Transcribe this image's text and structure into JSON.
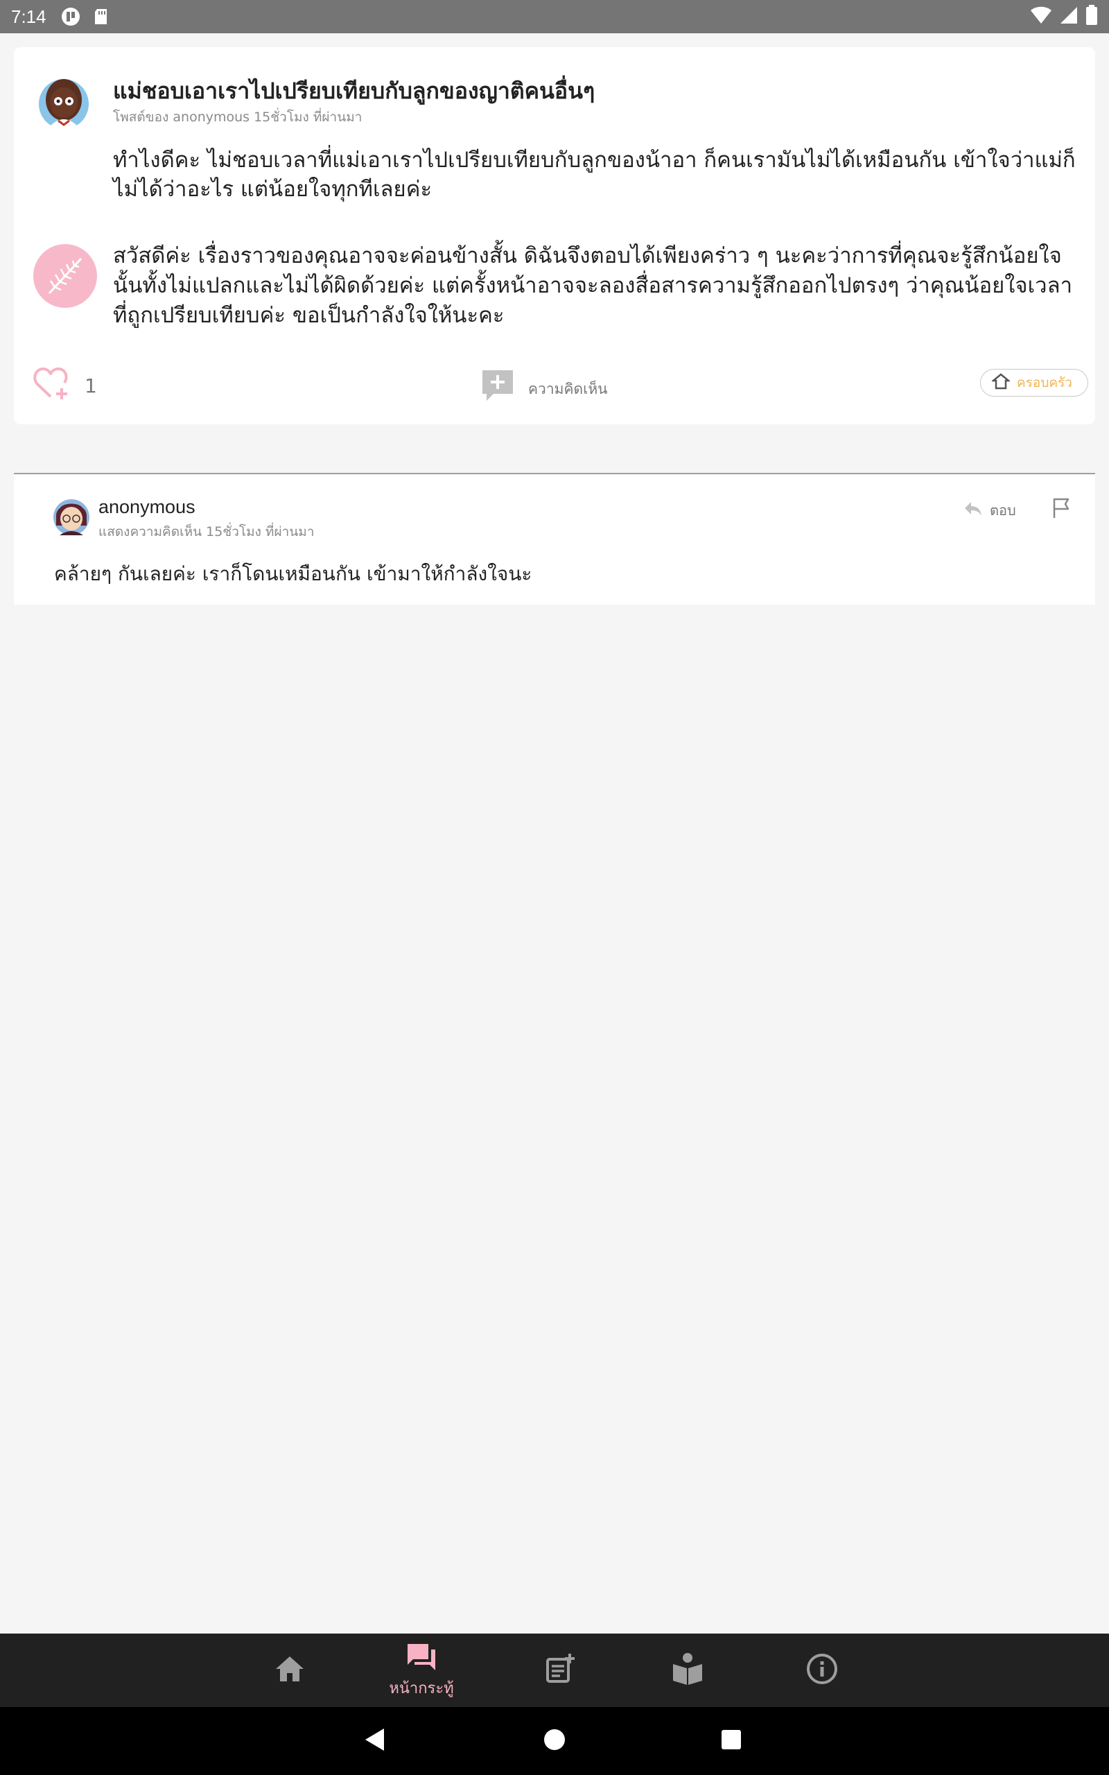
{
  "status_bar": {
    "time": "7:14",
    "icons": [
      "app-notification-icon",
      "sd-card-icon",
      "wifi-icon",
      "signal-icon",
      "battery-icon"
    ]
  },
  "post": {
    "title": "แม่ชอบเอาเราไปเปรียบเทียบกับลูกของญาติคนอื่นๆ",
    "meta": "โพสต์ของ anonymous 15ชั่วโมง ที่ผ่านมา",
    "body": "ทำไงดีคะ ไม่ชอบเวลาที่แม่เอาเราไปเปรียบเทียบกับลูกของน้าอา ก็คนเรามันไม่ได้เหมือนกัน เข้าใจว่าแม่ก็ไม่ได้ว่าอะไร แต่น้อยใจทุกทีเลยค่ะ",
    "reply": "สวัสดีค่ะ เรื่องราวของคุณอาจจะค่อนข้างสั้น ดิฉันจึงตอบได้เพียงคร่าว ๆ นะคะว่าการที่คุณจะรู้สึกน้อยใจนั้นทั้งไม่แปลกและไม่ได้ผิดด้วยค่ะ แต่ครั้งหน้าอาจจะลองสื่อสารความรู้สึกออกไปตรงๆ ว่าคุณน้อยใจเวลาที่ถูกเปรียบเทียบค่ะ ขอเป็นกำลังใจให้นะคะ",
    "like_count": "1",
    "comment_label": "ความคิดเห็น",
    "category": "ครอบครัว"
  },
  "comment": {
    "author": "anonymous",
    "meta": "แสดงความคิดเห็น 15ชั่วโมง ที่ผ่านมา",
    "reply_label": "ตอบ",
    "text": "คล้ายๆ กันเลยค่ะ เราก็โดนเหมือนกัน เข้ามาให้กำลังใจนะ"
  },
  "bottom_nav": {
    "active_label": "หน้ากระทู้",
    "items": [
      "home-icon",
      "forum-icon",
      "new-post-icon",
      "reader-icon",
      "info-icon"
    ]
  },
  "colors": {
    "accent_pink": "#f7b2c3",
    "category_orange": "#f3b352",
    "nav_bg": "#212121",
    "status_bg": "#757575"
  }
}
